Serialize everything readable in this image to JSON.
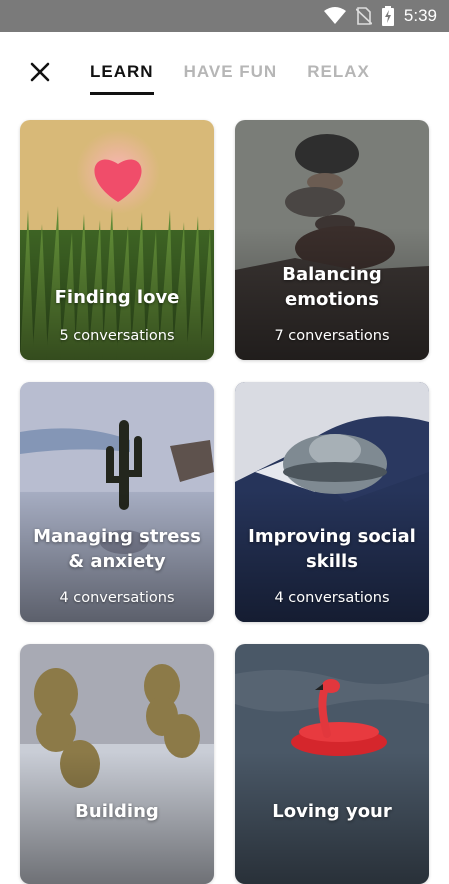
{
  "status_bar": {
    "time": "5:39",
    "icons": [
      "wifi-icon",
      "no-sim-icon",
      "battery-charging-icon"
    ]
  },
  "header": {
    "close_icon": "close-icon",
    "tabs": [
      {
        "label": "LEARN",
        "active": true
      },
      {
        "label": "HAVE FUN",
        "active": false
      },
      {
        "label": "RELAX",
        "active": false
      }
    ]
  },
  "cards": [
    {
      "title": "Finding love",
      "subtitle": "5 conversations"
    },
    {
      "title": "Balancing emotions",
      "subtitle": "7 conversations"
    },
    {
      "title": "Managing stress & anxiety",
      "subtitle": "4 conversations"
    },
    {
      "title": "Improving social skills",
      "subtitle": "4 conversations"
    },
    {
      "title": "Building",
      "subtitle": ""
    },
    {
      "title": "Loving your",
      "subtitle": ""
    }
  ],
  "colors": {
    "active_tab": "#111111",
    "inactive_tab": "#b6b6b6",
    "status_bar": "#7a7a7a"
  }
}
